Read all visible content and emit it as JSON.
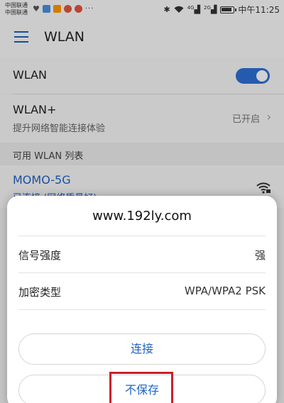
{
  "status_bar": {
    "carrier_1": "中国联通",
    "carrier_2": "中国联通",
    "more": "···",
    "time": "中午11:25",
    "signal_1": "4G",
    "signal_2": "2G"
  },
  "app_bar": {
    "title": "WLAN"
  },
  "settings": {
    "wlan_label": "WLAN",
    "wlan_on": true,
    "wlan_plus_label": "WLAN+",
    "wlan_plus_sub": "提升网络智能连接体验",
    "wlan_plus_state": "已开启",
    "section_title": "可用 WLAN 列表",
    "network_name": "MOMO-5G",
    "network_status": "已连接 (网络质量好)"
  },
  "dialog": {
    "title": "www.192ly.com",
    "rows": [
      {
        "key": "信号强度",
        "value": "强"
      },
      {
        "key": "加密类型",
        "value": "WPA/WPA2 PSK"
      }
    ],
    "connect_label": "连接",
    "forget_label": "不保存"
  },
  "colors": {
    "accent": "#1e63c4",
    "highlight": "#c8202b"
  }
}
